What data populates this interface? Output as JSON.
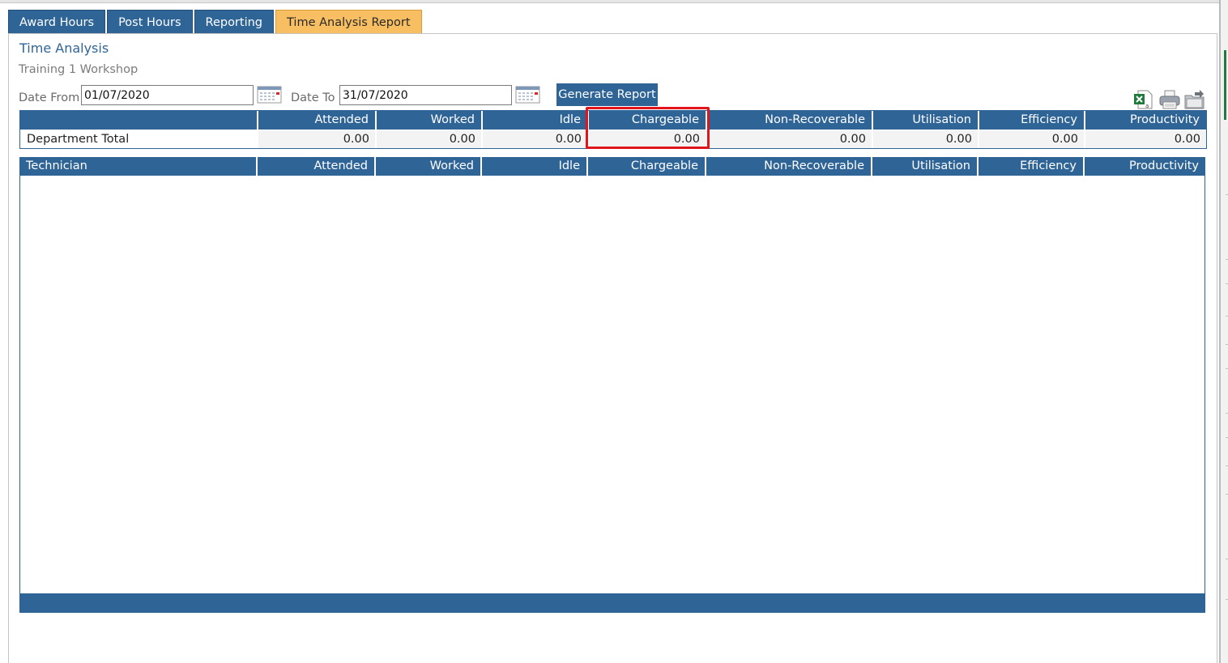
{
  "tabs": [
    {
      "label": "Award Hours",
      "active": false
    },
    {
      "label": "Post Hours",
      "active": false
    },
    {
      "label": "Reporting",
      "active": false
    },
    {
      "label": "Time Analysis Report",
      "active": true
    }
  ],
  "page": {
    "title": "Time Analysis",
    "subtitle": "Training 1 Workshop"
  },
  "filters": {
    "date_from_label": "Date From",
    "date_from_value": "01/07/2020",
    "date_to_label": "Date To",
    "date_to_value": "31/07/2020",
    "generate_label": "Generate Report"
  },
  "toolbar_icons": [
    "excel-export-icon",
    "print-icon",
    "export-folder-icon"
  ],
  "summary_table": {
    "columns": [
      "",
      "Attended",
      "Worked",
      "Idle",
      "Chargeable",
      "Non-Recoverable",
      "Utilisation",
      "Efficiency",
      "Productivity"
    ],
    "rows": [
      [
        "Department Total",
        "0.00",
        "0.00",
        "0.00",
        "0.00",
        "0.00",
        "0.00",
        "0.00",
        "0.00"
      ]
    ]
  },
  "technician_table": {
    "columns": [
      "Technician",
      "Attended",
      "Worked",
      "Idle",
      "Chargeable",
      "Non-Recoverable",
      "Utilisation",
      "Efficiency",
      "Productivity"
    ],
    "rows": []
  },
  "colors": {
    "header_blue": "#2f6497",
    "active_tab": "#f8be62",
    "highlight": "#e2141c"
  }
}
